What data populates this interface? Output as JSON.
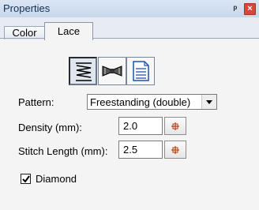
{
  "window": {
    "title": "Properties",
    "pin_icon": "pin-icon",
    "close_icon": "close-icon"
  },
  "tabs": [
    {
      "label": "Color",
      "active": false
    },
    {
      "label": "Lace",
      "active": true
    }
  ],
  "lace_type_buttons": [
    {
      "icon": "zigzag-stitch-icon",
      "selected": true
    },
    {
      "icon": "bowtie-lace-icon",
      "selected": false
    },
    {
      "icon": "document-lines-icon",
      "selected": false
    }
  ],
  "form": {
    "pattern_label": "Pattern:",
    "pattern_value": "Freestanding (double)",
    "density_label": "Density (mm):",
    "density_value": "2.0",
    "stitch_length_label": "Stitch Length (mm):",
    "stitch_length_value": "2.5",
    "diamond_label": "Diamond",
    "diamond_checked": true
  },
  "colors": {
    "titlebar": "#c7d7ec",
    "close": "#d9463b",
    "panel": "#f4f4f4"
  }
}
